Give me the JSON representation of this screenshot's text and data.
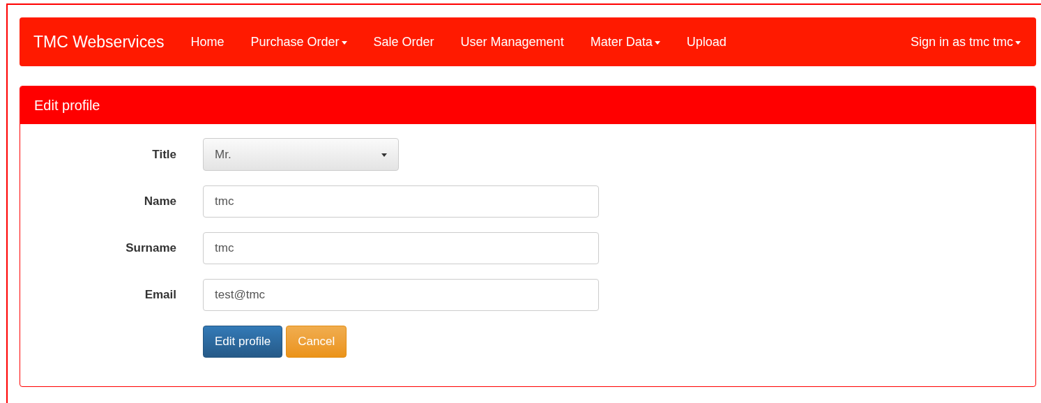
{
  "navbar": {
    "brand": "TMC Webservices",
    "items": [
      {
        "label": "Home",
        "has_menu": false
      },
      {
        "label": "Purchase Order",
        "has_menu": true
      },
      {
        "label": "Sale Order",
        "has_menu": false
      },
      {
        "label": "User Management",
        "has_menu": false
      },
      {
        "label": "Mater Data",
        "has_menu": true
      },
      {
        "label": "Upload",
        "has_menu": false
      }
    ],
    "user_menu": {
      "label": "Sign in as tmc tmc",
      "has_menu": true
    }
  },
  "panel": {
    "title": "Edit profile",
    "fields": [
      {
        "kind": "select",
        "label": "Title",
        "value": "Mr."
      },
      {
        "kind": "text",
        "label": "Name",
        "value": "tmc"
      },
      {
        "kind": "text",
        "label": "Surname",
        "value": "tmc"
      },
      {
        "kind": "text",
        "label": "Email",
        "value": "test@tmc"
      }
    ],
    "buttons": [
      {
        "kind": "primary",
        "label": "Edit profile"
      },
      {
        "kind": "warning",
        "label": "Cancel"
      }
    ]
  }
}
